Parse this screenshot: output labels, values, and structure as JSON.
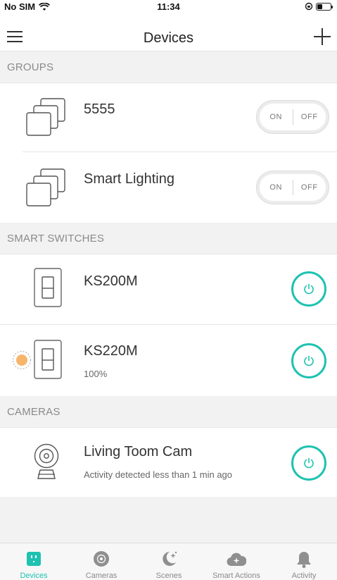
{
  "status_bar": {
    "carrier": "No SIM",
    "time": "11:34"
  },
  "header": {
    "title": "Devices"
  },
  "sections": {
    "groups": "GROUPS",
    "switches": "SMART SWITCHES",
    "cameras": "CAMERAS"
  },
  "groups": [
    {
      "name": "5555",
      "on_label": "ON",
      "off_label": "OFF"
    },
    {
      "name": "Smart Lighting",
      "on_label": "ON",
      "off_label": "OFF"
    }
  ],
  "switches": [
    {
      "name": "KS200M",
      "status": ""
    },
    {
      "name": "KS220M",
      "status": "100%"
    }
  ],
  "cameras": [
    {
      "name": "Living Toom Cam",
      "status": "Activity detected less than 1 min ago"
    }
  ],
  "tabs": [
    {
      "label": "Devices",
      "icon": "devices-icon",
      "active": true
    },
    {
      "label": "Cameras",
      "icon": "camera-lens-icon",
      "active": false
    },
    {
      "label": "Scenes",
      "icon": "moon-stars-icon",
      "active": false
    },
    {
      "label": "Smart Actions",
      "icon": "cloud-sparkle-icon",
      "active": false
    },
    {
      "label": "Activity",
      "icon": "bell-icon",
      "active": false
    }
  ],
  "colors": {
    "accent": "#1ec2b1",
    "background": "#f2f2f2",
    "dimmer_dot": "#f6b56b",
    "inactive_tab": "#8a8a8a"
  }
}
